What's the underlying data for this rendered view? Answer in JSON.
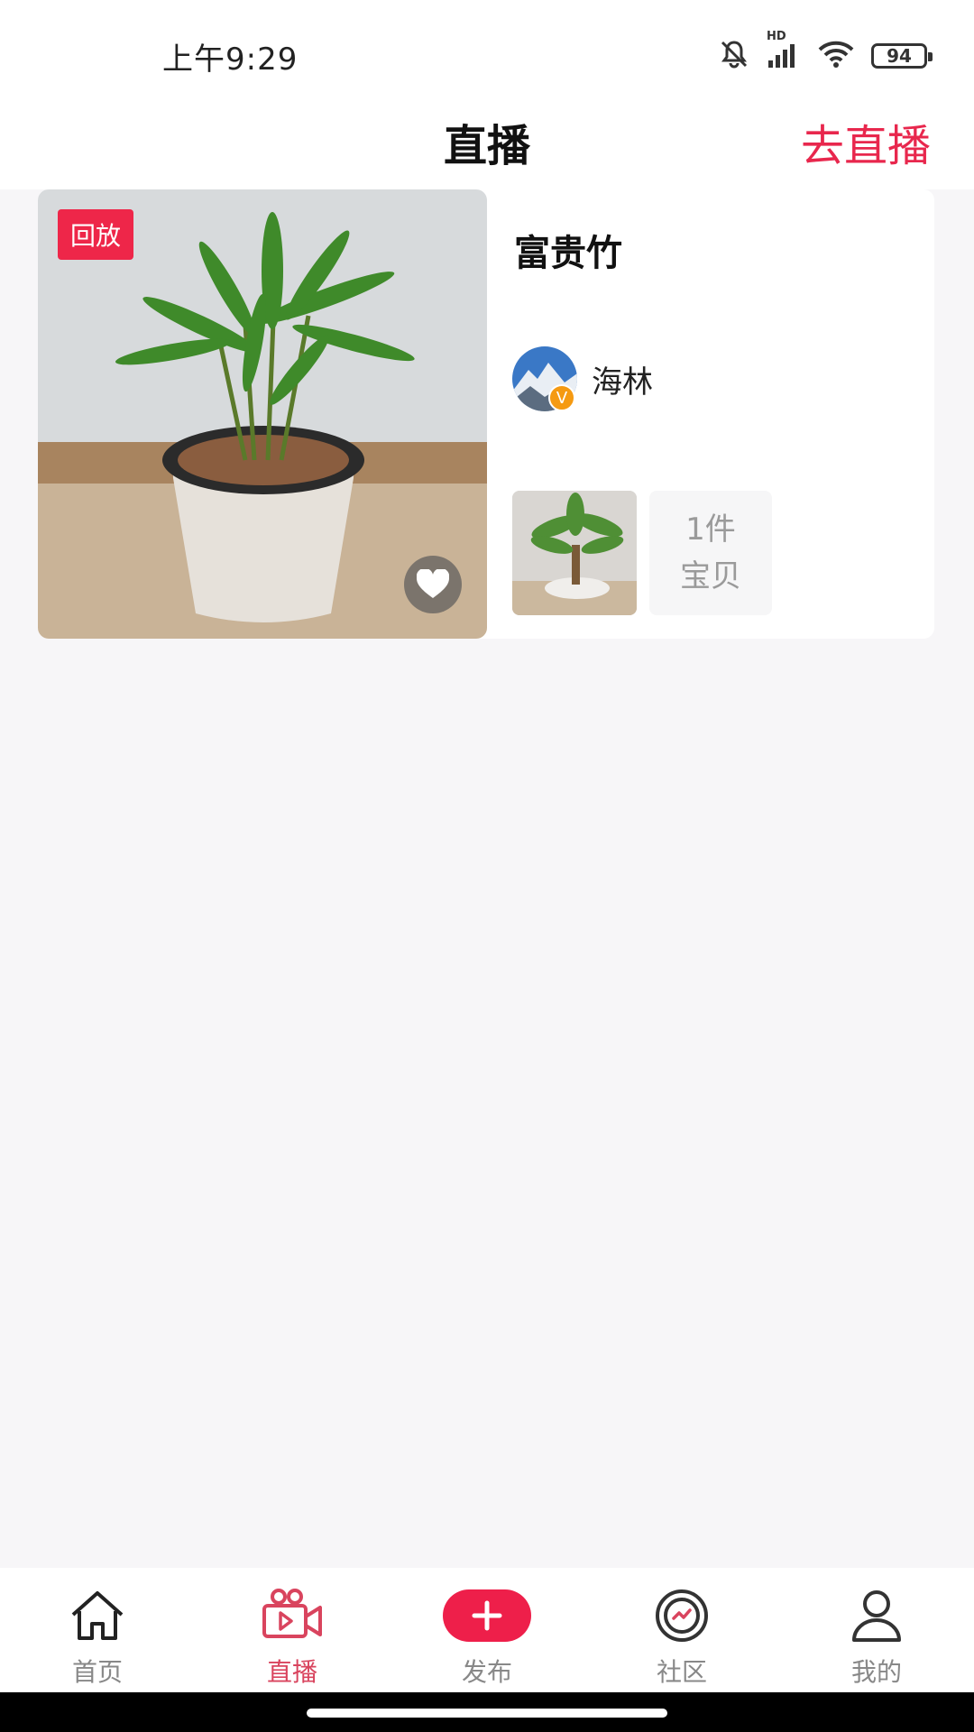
{
  "status_bar": {
    "time": "上午9:29",
    "network_label": "HD",
    "battery": "94"
  },
  "header": {
    "title": "直播",
    "go_live_label": "去直播"
  },
  "live_card": {
    "badge": "回放",
    "title": "富贵竹",
    "author_name": "海林",
    "verified_mark": "V",
    "product_count_line1": "1件",
    "product_count_line2": "宝贝"
  },
  "bottom_nav": {
    "items": [
      {
        "label": "首页",
        "icon": "home-icon"
      },
      {
        "label": "直播",
        "icon": "video-camera-icon"
      },
      {
        "label": "发布",
        "icon": "plus-icon"
      },
      {
        "label": "社区",
        "icon": "community-icon"
      },
      {
        "label": "我的",
        "icon": "user-icon"
      }
    ],
    "active_index": 1
  },
  "colors": {
    "accent": "#e8274d",
    "background": "#f7f6f8",
    "nav_active": "#d9445e"
  }
}
